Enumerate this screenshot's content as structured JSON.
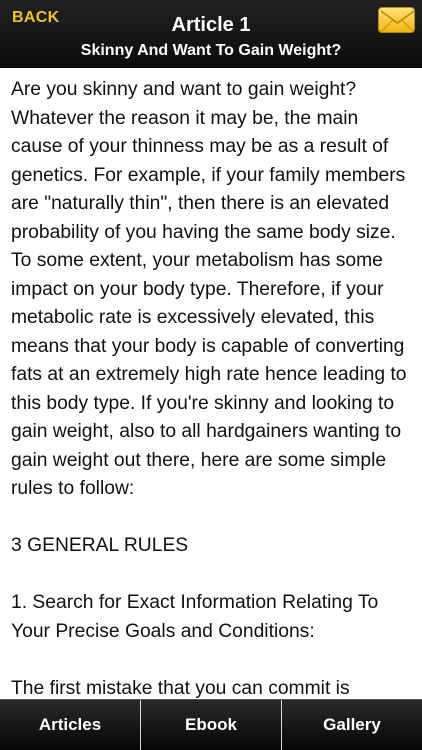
{
  "header": {
    "back_label": "BACK",
    "title": "Article 1",
    "subtitle": "Skinny And Want To Gain Weight?",
    "mail_icon": "envelope-icon"
  },
  "article": {
    "paragraphs": [
      "Are you skinny and want to gain weight? Whatever the reason it may be, the main cause of your thinness may be as a result of genetics. For example, if your family members are \"naturally thin\", then there is an elevated probability of you having the same body size. To some extent, your metabolism has some impact on your body type. Therefore, if your metabolic rate is excessively elevated, this means that your body is capable of converting fats at an extremely high rate hence leading to this body type. If you're skinny and looking to gain weight, also to all hardgainers wanting to gain weight out there, here are some simple rules to follow:",
      "3 GENERAL RULES",
      "1. Search for Exact Information Relating To Your Precise Goals and Conditions:",
      "The first mistake that you can commit is"
    ]
  },
  "tabs": [
    {
      "label": "Articles"
    },
    {
      "label": "Ebook"
    },
    {
      "label": "Gallery"
    }
  ],
  "colors": {
    "accent": "#f2c31f",
    "bar_background": "#111111",
    "text": "#111111"
  }
}
